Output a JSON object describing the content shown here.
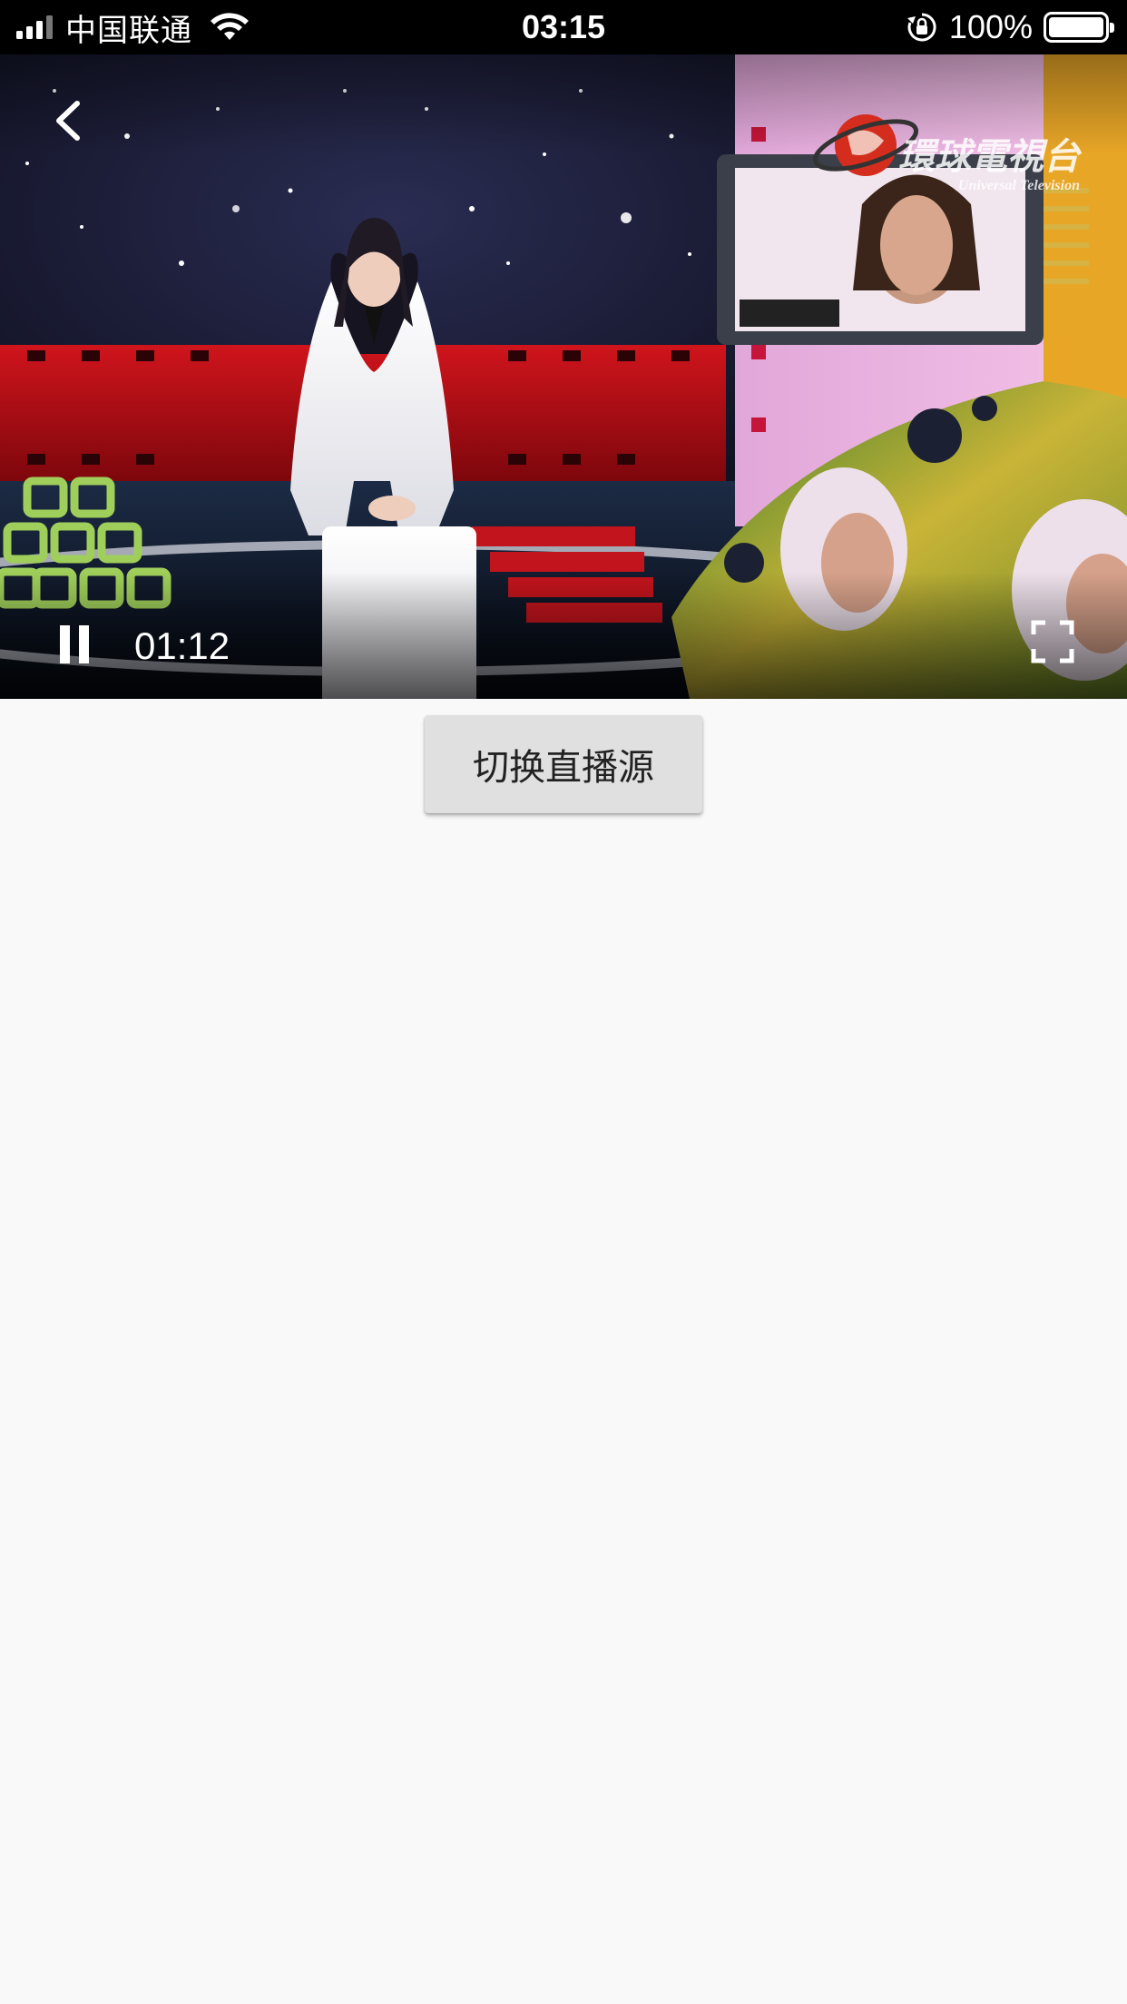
{
  "status_bar": {
    "carrier": "中国联通",
    "time": "03:15",
    "battery_percent": "100%",
    "signal_bars_active": 3,
    "battery_level": 1.0
  },
  "player": {
    "elapsed_time": "01:12",
    "state": "playing",
    "station_logo_text": "環球電視台",
    "station_logo_sub": "Universal Television",
    "icons": {
      "back": "chevron-left-icon",
      "pause": "pause-icon",
      "fullscreen": "fullscreen-icon"
    }
  },
  "actions": {
    "switch_source_label": "切换直播源"
  },
  "colors": {
    "status_bar_bg": "#000000",
    "page_bg": "#f9f9f9",
    "button_bg": "#e0e0e0",
    "button_text": "#222222"
  }
}
